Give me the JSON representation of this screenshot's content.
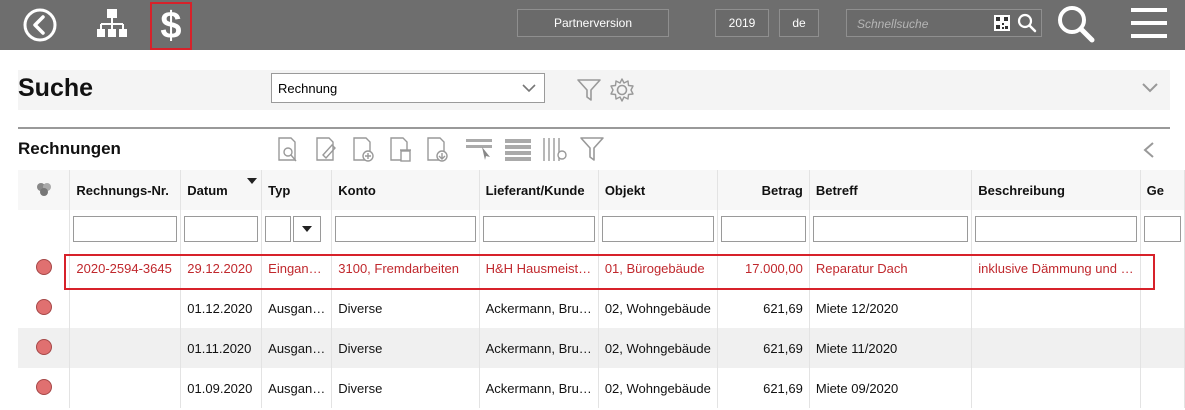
{
  "topbar": {
    "partner_label": "Partnerversion",
    "year": "2019",
    "lang": "de",
    "search_placeholder": "Schnellsuche"
  },
  "header": {
    "title": "Suche",
    "select_value": "Rechnung"
  },
  "section": {
    "title": "Rechnungen"
  },
  "table": {
    "columns": [
      "Rechnungs-Nr.",
      "Datum",
      "Typ",
      "Konto",
      "Lieferant/Kunde",
      "Objekt",
      "Betrag",
      "Betreff",
      "Beschreibung",
      "Ge"
    ],
    "rows": [
      [
        "2020-2594-3645",
        "29.12.2020",
        "Eingan…",
        "3100, Fremdarbeiten",
        "H&H Hausmeist…",
        "01, Bürogebäude",
        "17.000,00",
        "Reparatur Dach",
        "inklusive Dämmung und …",
        ""
      ],
      [
        "",
        "01.12.2020",
        "Ausgan…",
        "Diverse",
        "Ackermann, Bru…",
        "02, Wohngebäude",
        "621,69",
        "Miete 12/2020",
        "",
        ""
      ],
      [
        "",
        "01.11.2020",
        "Ausgan…",
        "Diverse",
        "Ackermann, Bru…",
        "02, Wohngebäude",
        "621,69",
        "Miete 11/2020",
        "",
        ""
      ],
      [
        "",
        "01.09.2020",
        "Ausgan…",
        "Diverse",
        "Ackermann, Bru…",
        "02, Wohngebäude",
        "621,69",
        "Miete 09/2020",
        "",
        ""
      ]
    ]
  },
  "colors": {
    "topbar": "#6e6e6e",
    "highlight": "#d7212a",
    "status_dot": "#e07070"
  }
}
